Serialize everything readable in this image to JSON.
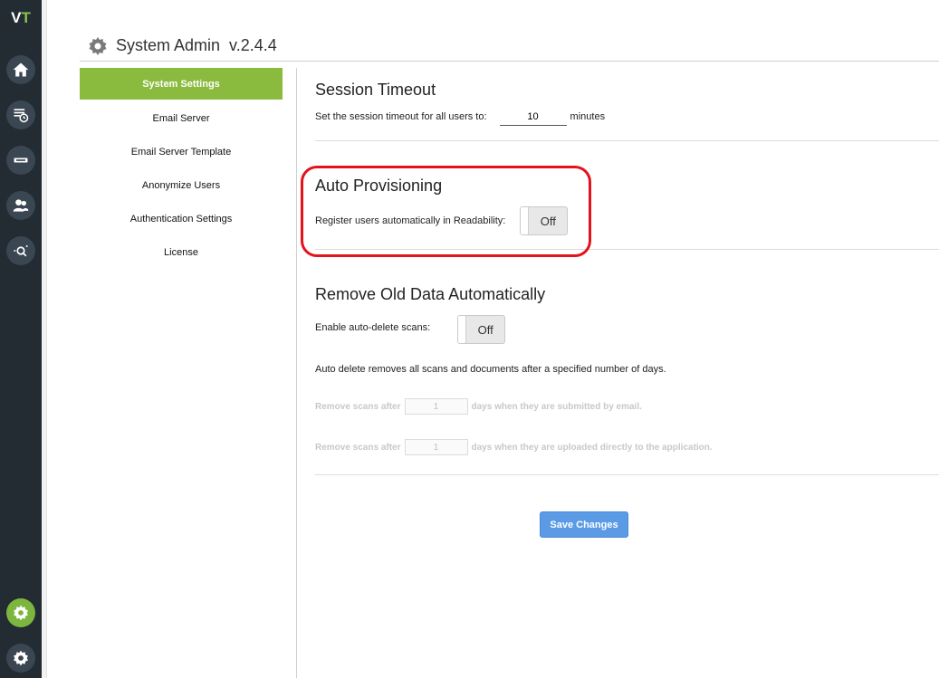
{
  "logo": {
    "v": "V",
    "t": "T"
  },
  "rail": {
    "icons": [
      "home-icon",
      "schedule-list-icon",
      "scanner-icon",
      "users-icon",
      "analytics-icon",
      "admin-settings-icon",
      "gear-icon"
    ]
  },
  "header": {
    "title": "System Admin",
    "version": "v.2.4.4"
  },
  "nav": {
    "items": [
      {
        "label": "System Settings",
        "active": true
      },
      {
        "label": "Email Server"
      },
      {
        "label": "Email Server Template"
      },
      {
        "label": "Anonymize Users"
      },
      {
        "label": "Authentication Settings"
      },
      {
        "label": "License"
      }
    ]
  },
  "session": {
    "title": "Session Timeout",
    "label": "Set the session timeout for all users to:",
    "value": "10",
    "unit": "minutes"
  },
  "provisioning": {
    "title": "Auto Provisioning",
    "label": "Register users automatically in Readability:",
    "toggle": "Off"
  },
  "remove": {
    "title": "Remove Old Data Automatically",
    "enable_label": "Enable auto-delete scans:",
    "toggle": "Off",
    "description": "Auto delete removes all scans and documents after a specified number of days.",
    "row1_prefix": "Remove scans after",
    "row1_value": "1",
    "row1_suffix": "days when they are submitted by email.",
    "row2_prefix": "Remove scans after",
    "row2_value": "1",
    "row2_suffix": "days when they are uploaded directly to the application."
  },
  "save_label": "Save Changes",
  "colors": {
    "accent": "#8bbb3e",
    "sidebar": "#232b33",
    "primary_button": "#5b9be6",
    "highlight": "#e3121b"
  }
}
